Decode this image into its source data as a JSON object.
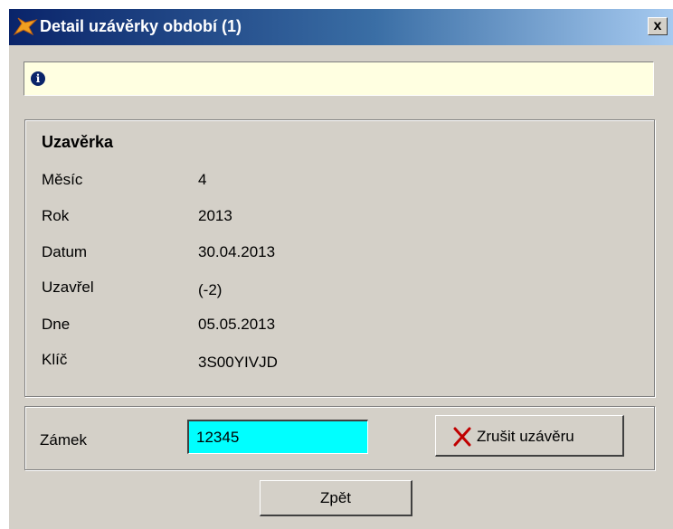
{
  "window": {
    "title": "Detail  uzávěrky období (1)",
    "title_icon": "fox-logo-icon",
    "close_label": "x"
  },
  "info_bar": {
    "icon": "info-icon"
  },
  "closure": {
    "group_title": "Uzavěrka",
    "fields": [
      {
        "label": "Měsíc",
        "value": "4"
      },
      {
        "label": "Rok",
        "value": "2013"
      },
      {
        "label": "Datum",
        "value": "30.04.2013"
      },
      {
        "label": "Uzavřel",
        "value": "(-2)"
      },
      {
        "label": "Dne",
        "value": "05.05.2013"
      },
      {
        "label": "Klíč",
        "value": "3S00YIVJD"
      }
    ]
  },
  "lock": {
    "label": "Zámek",
    "value": "12345",
    "cancel_button_label": "Zrušit uzávěru",
    "cancel_button_icon": "red-x-icon"
  },
  "footer": {
    "back_button_label": "Zpět"
  },
  "colors": {
    "titlebar_start": "#0a246a",
    "titlebar_end": "#a6caf0",
    "info_bg": "#ffffe1",
    "input_bg": "#00ffff",
    "dialog_bg": "#d4d0c8",
    "cancel_icon": "#c00000"
  }
}
